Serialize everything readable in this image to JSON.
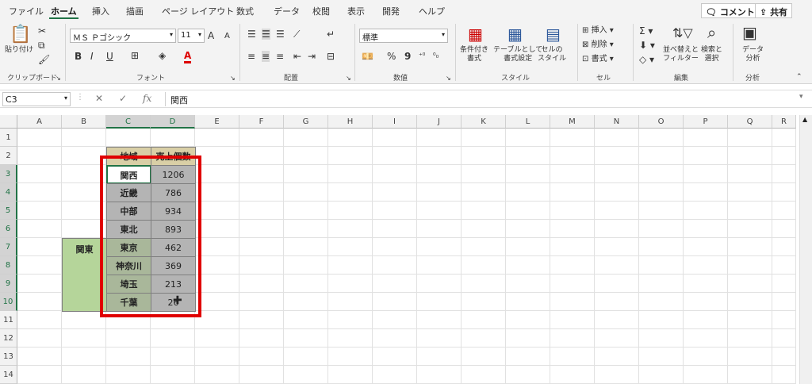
{
  "tabs": [
    "ファイル",
    "ホーム",
    "挿入",
    "描画",
    "ページ レイアウト",
    "数式",
    "データ",
    "校閲",
    "表示",
    "開発",
    "ヘルプ"
  ],
  "active_tab": "ホーム",
  "comment_button": "コメント",
  "share_button": "共有",
  "ribbon": {
    "clipboard": {
      "paste": "貼り付け",
      "label": "クリップボード"
    },
    "font": {
      "name": "ＭＳ Ｐゴシック",
      "size": "11",
      "label": "フォント",
      "bold": "B",
      "italic": "I",
      "underline": "U",
      "grow": "A",
      "shrink": "A",
      "color": "A"
    },
    "alignment": {
      "label": "配置"
    },
    "number": {
      "format": "標準",
      "percent": "%",
      "comma": "9",
      "label": "数値"
    },
    "styles": {
      "conditional": "条件付き\n書式",
      "table": "テーブルとして\n書式設定",
      "cell_style": "セルの\nスタイル",
      "label": "スタイル"
    },
    "cells": {
      "insert": "挿入",
      "delete": "削除",
      "format": "書式",
      "label": "セル"
    },
    "editing": {
      "sort": "並べ替えと\nフィルター",
      "find": "検索と\n選択",
      "label": "編集"
    },
    "analysis": {
      "data_analysis": "データ\n分析",
      "label": "分析"
    }
  },
  "formula_bar": {
    "name_box": "C3",
    "fx": "fx",
    "value": "関西"
  },
  "columns": [
    "A",
    "B",
    "C",
    "D",
    "E",
    "F",
    "G",
    "H",
    "I",
    "J",
    "K",
    "L",
    "M",
    "N",
    "O",
    "P",
    "Q",
    "R"
  ],
  "rows": [
    "1",
    "2",
    "3",
    "4",
    "5",
    "6",
    "7",
    "8",
    "9",
    "10",
    "11",
    "12",
    "13",
    "14"
  ],
  "table": {
    "header": [
      "地域",
      "売上個数"
    ],
    "rows": [
      [
        "関西",
        "1206"
      ],
      [
        "近畿",
        "786"
      ],
      [
        "中部",
        "934"
      ],
      [
        "東北",
        "893"
      ],
      [
        "東京",
        "462"
      ],
      [
        "神奈川",
        "369"
      ],
      [
        "埼玉",
        "213"
      ],
      [
        "千葉",
        "26"
      ]
    ]
  },
  "merged_label": "関東",
  "colors": {
    "excel_green": "#217346",
    "highlight_red": "#e00000",
    "header_tan": "#d9cfa6",
    "gray_fill": "#b4b4b4",
    "green_fill": "#b5d59a"
  }
}
